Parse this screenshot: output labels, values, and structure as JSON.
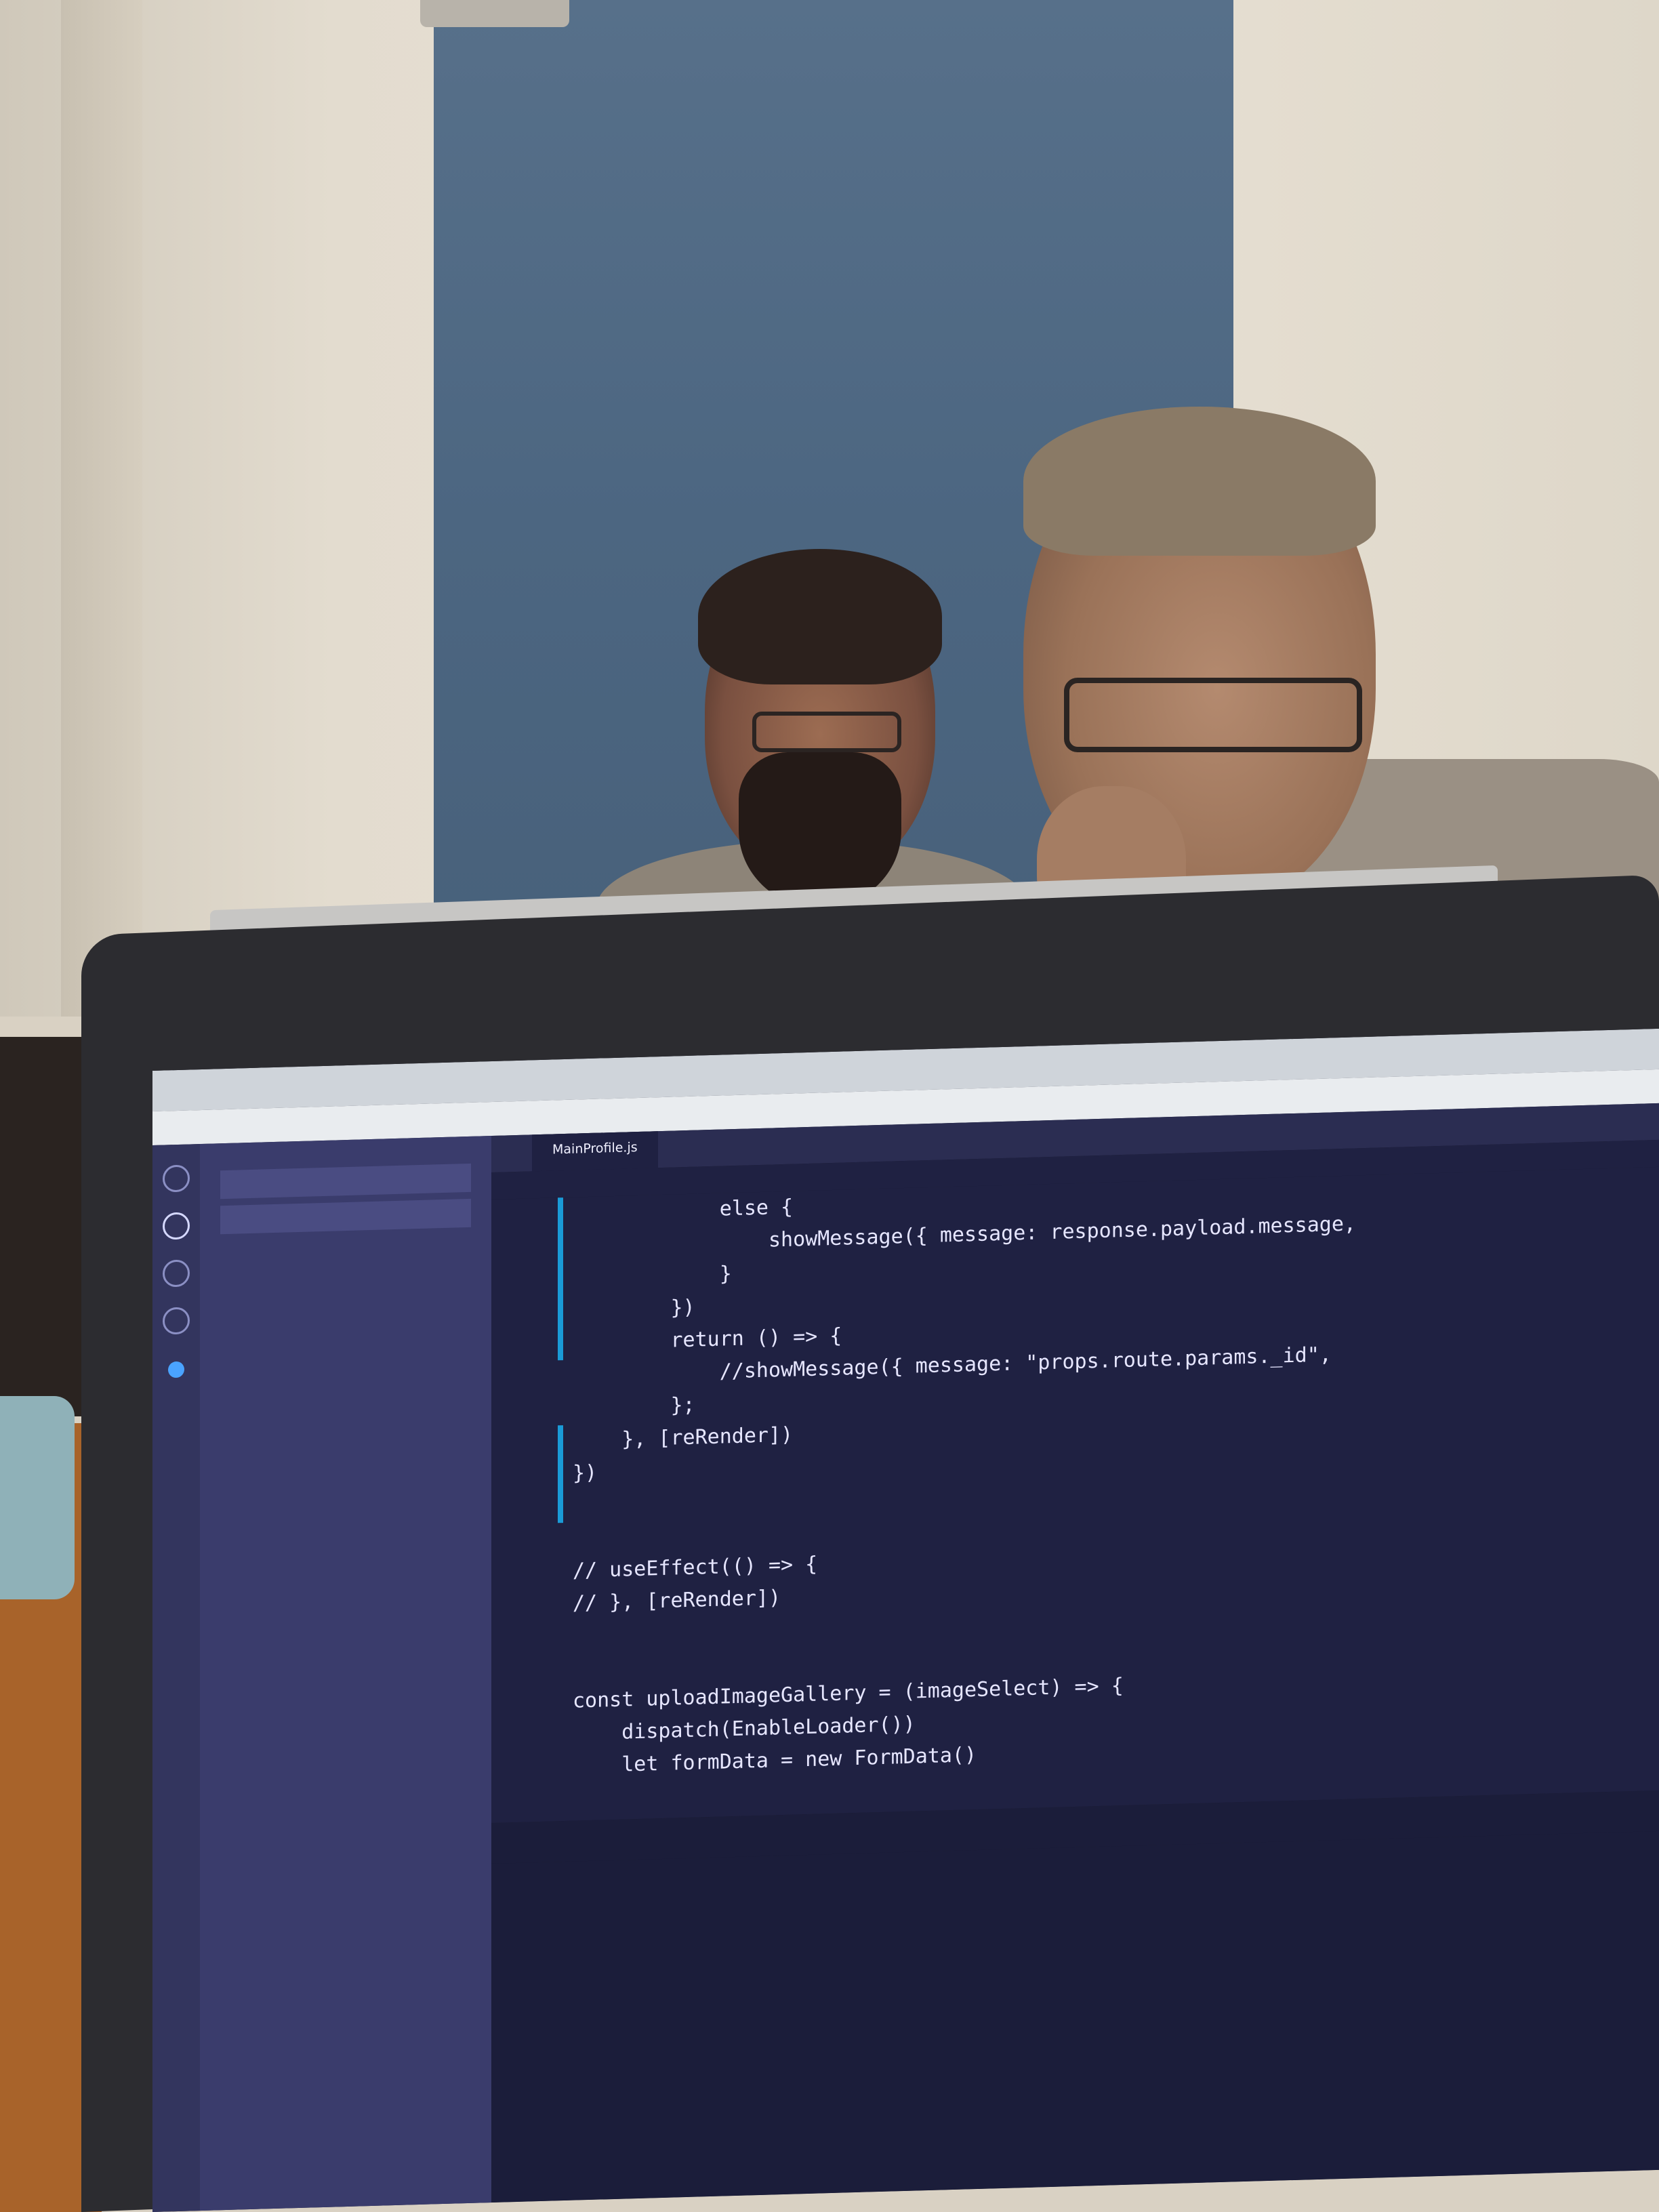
{
  "window": {
    "clock": "",
    "title": "",
    "menu": [
      "",
      "",
      "",
      "",
      "",
      "",
      "",
      "",
      ""
    ]
  },
  "sidebar": {
    "title": "",
    "search_value": "",
    "replace_value": "",
    "info": "",
    "results": []
  },
  "tabs": [
    {
      "label": "",
      "active": false
    },
    {
      "label": "MainProfile.js",
      "active": true
    },
    {
      "label": "",
      "active": false
    },
    {
      "label": "",
      "active": false
    }
  ],
  "breadcrumb": "",
  "editor": {
    "line_numbers": [
      "",
      "",
      "",
      "",
      "",
      "",
      "",
      "",
      "",
      "",
      "",
      "",
      "",
      "",
      "",
      "",
      "",
      "",
      ""
    ],
    "lines": [
      "            else {",
      "                showMessage({ message: response.payload.message,",
      "            }",
      "        })",
      "        return () => {",
      "            //showMessage({ message: \"props.route.params._id\",",
      "        };",
      "    }, [reRender])",
      "})",
      "",
      "",
      "// useEffect(() => {",
      "// }, [reRender])",
      "",
      "",
      "const uploadImageGallery = (imageSelect) => {",
      "    dispatch(EnableLoader())",
      "    let formData = new FormData()",
      ""
    ]
  },
  "panel": {
    "tabs": [
      "",
      "",
      "",
      ""
    ],
    "terminal_lines": [
      "",
      "",
      "",
      "",
      "",
      "",
      "",
      ""
    ]
  },
  "colors": {
    "editor_bg": "#1f2142",
    "sidebar_bg": "#3a3c6c",
    "activity_bg": "#33355e",
    "terminal_text": "#e06fc0",
    "accent": "#1a9bd7"
  }
}
